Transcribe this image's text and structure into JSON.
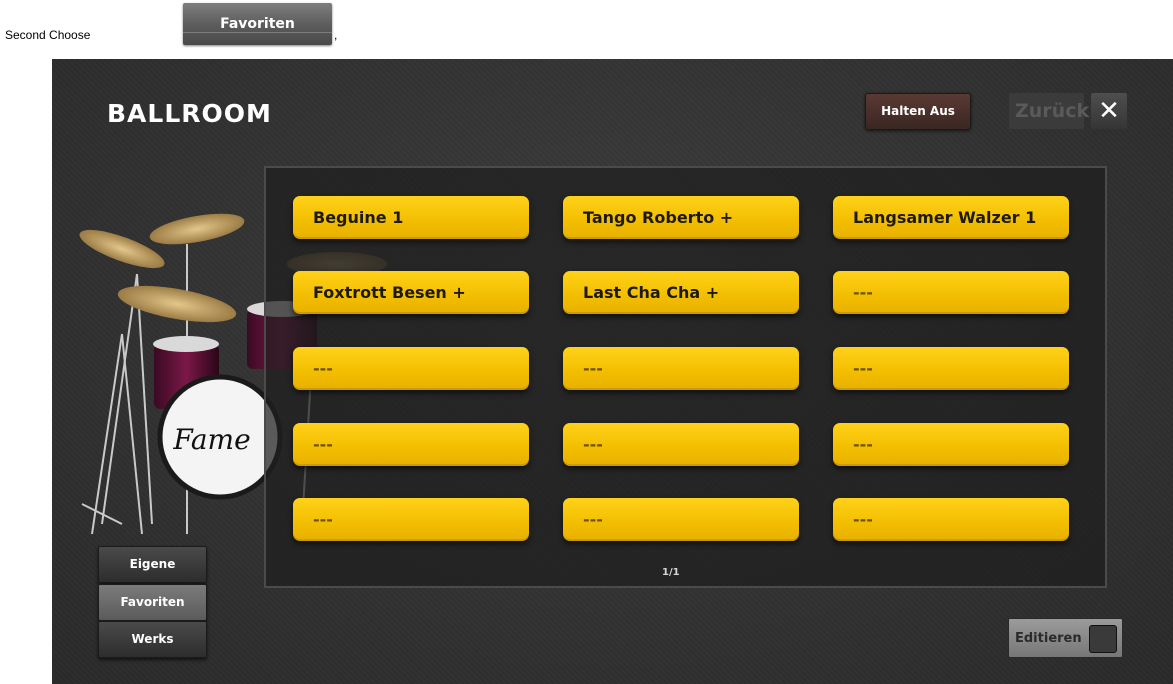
{
  "caption": {
    "text": "Second Choose",
    "button_label": "Favoriten",
    "trailing": ","
  },
  "header": {
    "title": "BALLROOM",
    "halten_label": "Halten Aus",
    "zurueck_label": "Zurück"
  },
  "grid": {
    "slots": [
      "Beguine 1",
      "Tango Roberto +",
      "Langsamer Walzer 1",
      "Foxtrott Besen +",
      "Last Cha Cha +",
      "---",
      "---",
      "---",
      "---",
      "---",
      "---",
      "---",
      "---",
      "---",
      "---"
    ],
    "pager": "1/1"
  },
  "sidebar": {
    "items": [
      {
        "label": "Eigene",
        "active": false
      },
      {
        "label": "Favoriten",
        "active": true
      },
      {
        "label": "Werks",
        "active": false
      }
    ]
  },
  "footer": {
    "edit_label": "Editieren"
  },
  "logo_text": "Fame",
  "colors": {
    "slot": "#f2bd00",
    "background": "#333333"
  }
}
